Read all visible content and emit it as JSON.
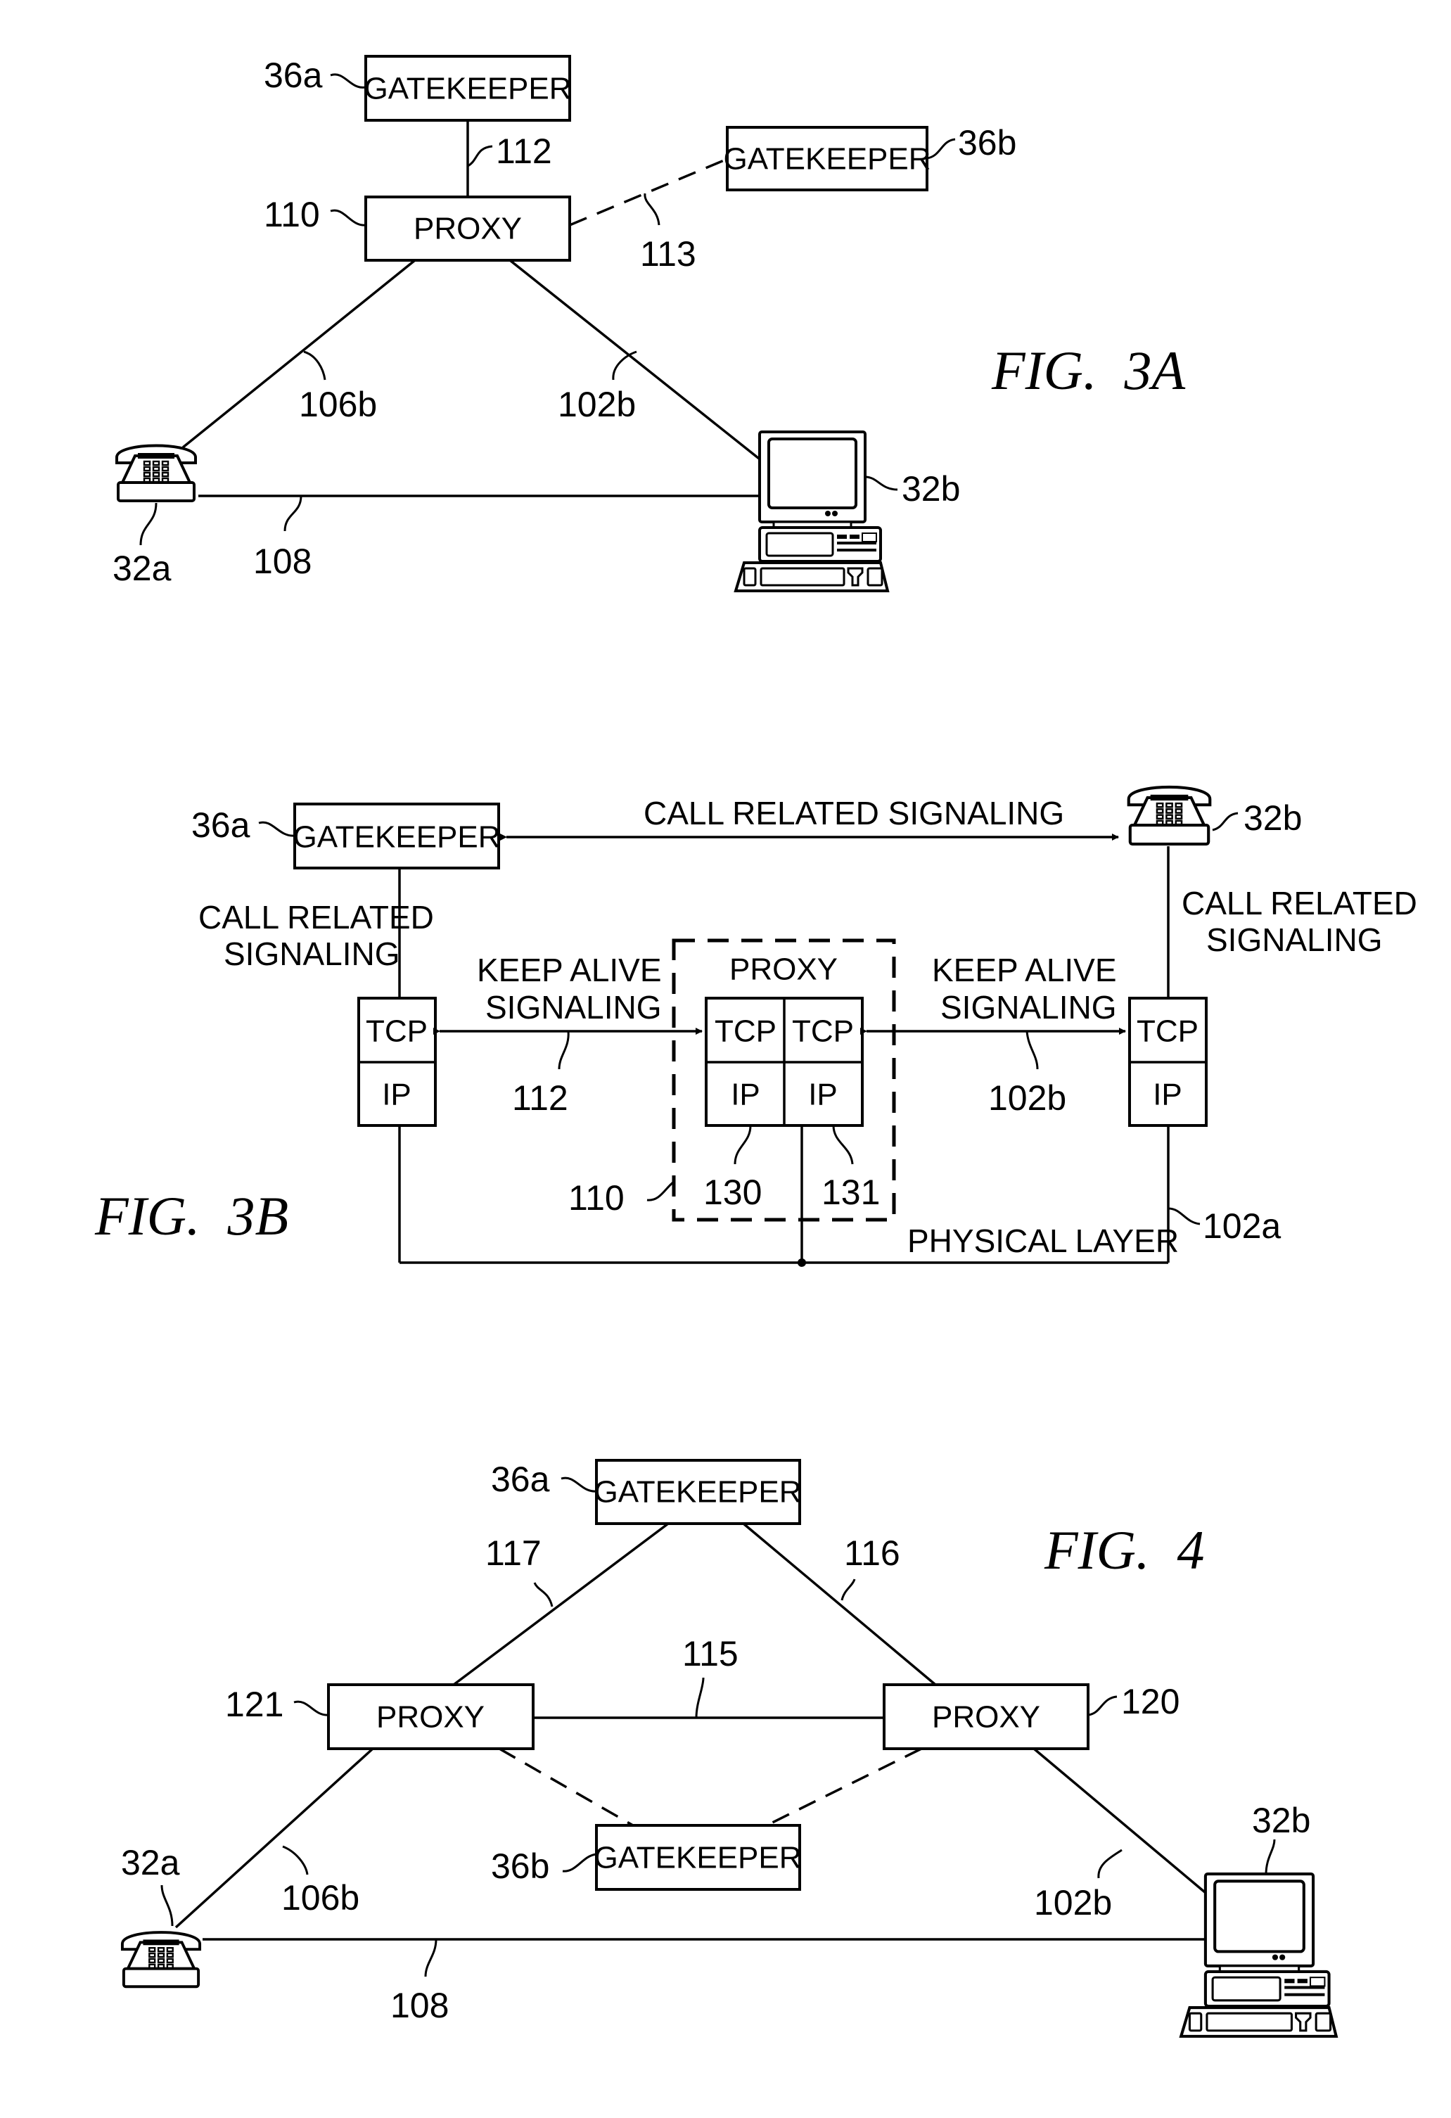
{
  "document": {
    "type": "patent drawing sheet",
    "figures": [
      {
        "id": "fig3a",
        "caption": "FIG.  3A",
        "nodes": {
          "gatekeeper_a": {
            "label": "GATEKEEPER",
            "ref": "36a"
          },
          "gatekeeper_b": {
            "label": "GATEKEEPER",
            "ref": "36b"
          },
          "proxy": {
            "label": "PROXY",
            "ref": "110"
          },
          "phone": {
            "ref": "32a",
            "icon": "telephone-icon"
          },
          "computer": {
            "ref": "32b",
            "icon": "computer-icon"
          }
        },
        "links": {
          "gk_proxy": "112",
          "proxy_gk_b": "113",
          "proxy_phone": "106b",
          "proxy_computer": "102b",
          "phone_computer": "108"
        }
      },
      {
        "id": "fig3b",
        "caption": "FIG.  3B",
        "nodes": {
          "gatekeeper": {
            "label": "GATEKEEPER",
            "ref": "36a"
          },
          "phone": {
            "ref": "32b",
            "icon": "telephone-icon"
          },
          "left_stack": {
            "tcp": "TCP",
            "ip": "IP"
          },
          "proxy": {
            "label": "PROXY",
            "ref": "110",
            "tcp_left": "TCP",
            "tcp_right": "TCP",
            "ip_left": "IP",
            "ip_right": "IP",
            "ref_left": "130",
            "ref_right": "131"
          },
          "right_stack": {
            "tcp": "TCP",
            "ip": "IP"
          }
        },
        "texts": {
          "top_signal": "CALL RELATED SIGNALING",
          "left_signal_1": "CALL RELATED",
          "left_signal_2": "SIGNALING",
          "right_signal_1": "CALL RELATED",
          "right_signal_2": "SIGNALING",
          "keep_alive_left_1": "KEEP ALIVE",
          "keep_alive_left_2": "SIGNALING",
          "keep_alive_right_1": "KEEP ALIVE",
          "keep_alive_right_2": "SIGNALING",
          "physical_layer": "PHYSICAL LAYER"
        },
        "links": {
          "keep_alive_left": "112",
          "keep_alive_right": "102b",
          "physical": "102a"
        }
      },
      {
        "id": "fig4",
        "caption": "FIG.  4",
        "nodes": {
          "gatekeeper_a": {
            "label": "GATEKEEPER",
            "ref": "36a"
          },
          "gatekeeper_b": {
            "label": "GATEKEEPER",
            "ref": "36b"
          },
          "proxy_left": {
            "label": "PROXY",
            "ref": "121"
          },
          "proxy_right": {
            "label": "PROXY",
            "ref": "120"
          },
          "phone": {
            "ref": "32a",
            "icon": "telephone-icon"
          },
          "computer": {
            "ref": "32b",
            "icon": "computer-icon"
          }
        },
        "links": {
          "gk_proxy_left": "117",
          "gk_proxy_right": "116",
          "proxy_proxy": "115",
          "proxy_left_phone": "106b",
          "proxy_right_computer": "102b",
          "phone_computer": "108"
        }
      }
    ]
  }
}
